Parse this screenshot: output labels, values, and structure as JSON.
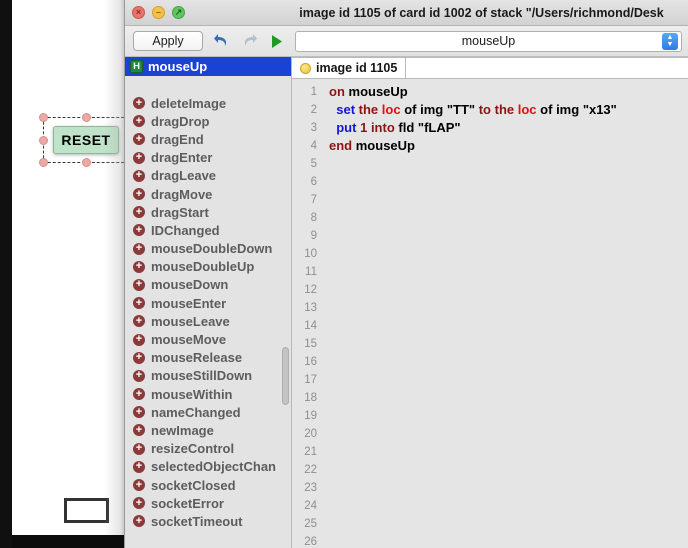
{
  "window": {
    "title": "image id 1105 of card id 1002 of stack \"/Users/richmond/Desk",
    "close_glyph": "×",
    "min_glyph": "–",
    "zoom_glyph": "↗"
  },
  "toolbar": {
    "apply_label": "Apply",
    "undo_glyph": "↶",
    "redo_glyph": "↷",
    "run_glyph": "▶",
    "handler_selected": "mouseUp",
    "stepper_up": "▲",
    "stepper_down": "▼"
  },
  "sidebar": {
    "selected": {
      "badge": "H",
      "label": "mouseUp"
    },
    "plus_glyph": "+",
    "items": [
      {
        "label": "deleteImage"
      },
      {
        "label": "dragDrop"
      },
      {
        "label": "dragEnd"
      },
      {
        "label": "dragEnter"
      },
      {
        "label": "dragLeave"
      },
      {
        "label": "dragMove"
      },
      {
        "label": "dragStart"
      },
      {
        "label": "IDChanged"
      },
      {
        "label": "mouseDoubleDown"
      },
      {
        "label": "mouseDoubleUp"
      },
      {
        "label": "mouseDown"
      },
      {
        "label": "mouseEnter"
      },
      {
        "label": "mouseLeave"
      },
      {
        "label": "mouseMove"
      },
      {
        "label": "mouseRelease"
      },
      {
        "label": "mouseStillDown"
      },
      {
        "label": "mouseWithin"
      },
      {
        "label": "nameChanged"
      },
      {
        "label": "newImage"
      },
      {
        "label": "resizeControl"
      },
      {
        "label": "selectedObjectChan"
      },
      {
        "label": "socketClosed"
      },
      {
        "label": "socketError"
      },
      {
        "label": "socketTimeout"
      }
    ]
  },
  "editor": {
    "tab_label": "image id 1105",
    "total_lines": 26,
    "lines": [
      "on mouseUp",
      "  set the loc of img \"TT\" to the loc of img \"x13\"",
      "  put 1 into fld \"fLAP\"",
      "end mouseUp"
    ]
  },
  "canvas": {
    "reset_button_label": "RESET"
  },
  "colors": {
    "selection_blue": "#1a43d6",
    "handle_pink": "#eda9a6",
    "reset_green": "#bfe3c9",
    "keyword_control": "#8c1414",
    "keyword_command": "#1414e0",
    "keyword_property": "#e01010"
  }
}
